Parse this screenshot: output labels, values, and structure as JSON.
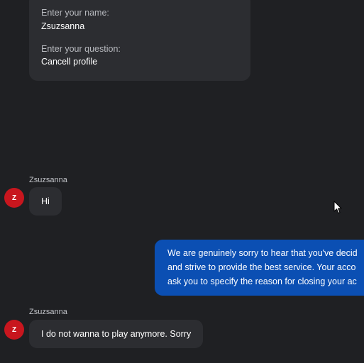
{
  "form": {
    "name_label": "Enter your name:",
    "name_value": "Zsuzsanna",
    "question_label": "Enter your question:",
    "question_value": "Cancell profile"
  },
  "messages": [
    {
      "sender": "Zsuzsanna",
      "avatar_letter": "Z",
      "text": "Hi"
    },
    {
      "direction": "outgoing",
      "lines": [
        "We are genuinely sorry to hear that you've decid",
        "and strive to provide the best service. Your acco",
        "ask you to specify the reason for closing your ac"
      ]
    },
    {
      "sender": "Zsuzsanna",
      "avatar_letter": "Z",
      "text": "I do not wanna to play anymore. Sorry"
    }
  ],
  "colors": {
    "background": "#1f2023",
    "incoming_bubble": "#2c2d31",
    "outgoing_bubble": "#0b4fb3",
    "avatar": "#c8161e"
  },
  "icons": {
    "cursor": "mouse-pointer-icon"
  }
}
